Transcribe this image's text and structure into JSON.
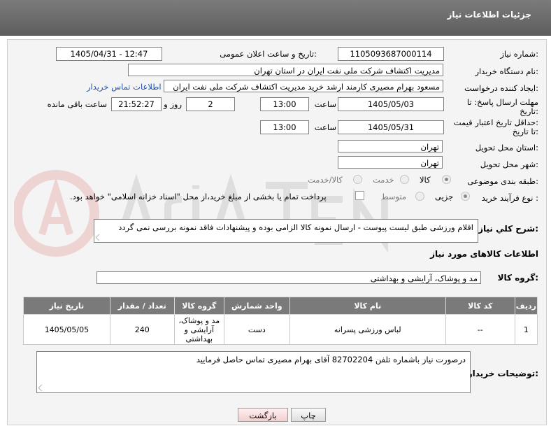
{
  "header": {
    "title": "جزئیات اطلاعات نیاز"
  },
  "fields": {
    "need_number_label": "شماره نیاز:",
    "need_number": "1105093687000114",
    "announce_label": "تاریخ و ساعت اعلان عمومی:",
    "announce_value": "1405/04/31 - 12:47",
    "buyer_org_label": "نام دستگاه خریدار:",
    "buyer_org": "مدیریت اکتشاف شرکت ملی نفت ایران در استان تهران",
    "requester_label": "ایجاد کننده درخواست:",
    "requester": "مسعود بهرام مصیری کارمند ارشد خرید مدیریت اکتشاف شرکت ملی نفت ایران",
    "contact_link": "اطلاعات تماس خریدار",
    "reply_deadline_label_1": "مهلت ارسال پاسخ: تا",
    "reply_deadline_label_2": "تاریخ:",
    "reply_date": "1405/05/03",
    "time_label": "ساعت",
    "reply_time": "13:00",
    "days_value": "2",
    "days_label": "روز و",
    "remaining_value": "21:52:27",
    "remaining_label": "ساعت باقی مانده",
    "price_deadline_label_1": "حداقل تاریخ اعتبار قیمت:",
    "price_deadline_label_2": "تا تاریخ:",
    "price_date": "1405/05/31",
    "price_time": "13:00",
    "province_label": "استان محل تحویل:",
    "province": "تهران",
    "city_label": "شهر محل تحویل:",
    "city": "تهران",
    "category_label": "طبقه بندی موضوعی:",
    "category_options": [
      "کالا",
      "خدمت",
      "کالا/خدمت"
    ],
    "purchase_type_label": "نوع فرآیند خرید :",
    "purchase_options": [
      "جزیی",
      "متوسط"
    ],
    "payment_note": "پرداخت تمام یا بخشی از مبلغ خرید،از محل \"اسناد خزانه اسلامی\" خواهد بود."
  },
  "description": {
    "label": "شرح كلي نياز:",
    "text": "اقلام ورزشی طبق لیست پیوست - ارسال نمونه کالا الزامی بوده و پیشنهادات فاقد نمونه بررسی نمی گردد"
  },
  "goods_info": {
    "title": "اطلاعات کالاهای مورد نیاز",
    "group_label": "گروه کالا:",
    "group_value": "مد و پوشاک، آرایشی و بهداشتی"
  },
  "table": {
    "headers": [
      "ردیف",
      "کد کالا",
      "نام کالا",
      "واحد شمارش",
      "گروه کالا",
      "تعداد / مقدار",
      "تاریخ نیاز"
    ],
    "rows": [
      [
        "1",
        "--",
        "لباس ورزشی پسرانه",
        "دست",
        "مد و پوشاک، آرایشی و بهداشتی",
        "240",
        "1405/05/05"
      ]
    ]
  },
  "buyer_notes": {
    "label": "توضیحات خریدار:",
    "text": "درصورت نیاز باشماره تلفن 82702204 آقای بهرام مصیری تماس حاصل فرمایید"
  },
  "buttons": {
    "print": "چاپ",
    "back": "بازگشت"
  },
  "colors": {
    "header_bg": "#666666",
    "link": "#1f4fa6",
    "table_header": "#7a7a7a",
    "back_button_bg": "#f9dcdc"
  }
}
